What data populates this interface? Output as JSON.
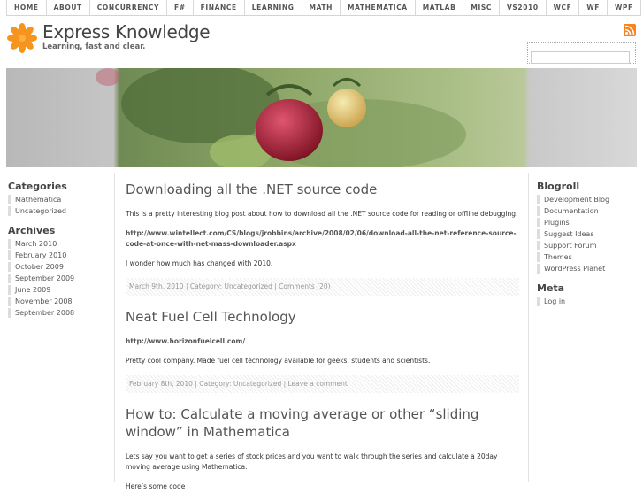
{
  "nav": [
    "HOME",
    "ABOUT",
    "CONCURRENCY",
    "F#",
    "FINANCE",
    "LEARNING",
    "MATH",
    "MATHEMATICA",
    "MATLAB",
    "MISC",
    "VS2010",
    "WCF",
    "WF",
    "WPF"
  ],
  "site": {
    "title": "Express Knowledge",
    "tagline": "Learning, fast and clear."
  },
  "sidebar_left": {
    "categories_heading": "Categories",
    "categories": [
      "Mathematica",
      "Uncategorized"
    ],
    "archives_heading": "Archives",
    "archives": [
      "March 2010",
      "February 2010",
      "October 2009",
      "September 2009",
      "June 2009",
      "November 2008",
      "September 2008"
    ]
  },
  "sidebar_right": {
    "blogroll_heading": "Blogroll",
    "blogroll": [
      "Development Blog",
      "Documentation",
      "Plugins",
      "Suggest Ideas",
      "Support Forum",
      "Themes",
      "WordPress Planet"
    ],
    "meta_heading": "Meta",
    "meta": [
      "Log in"
    ]
  },
  "posts": [
    {
      "title": "Downloading all the .NET source code",
      "intro": "This is a pretty interesting blog post about how to download all the .NET source code for reading  or offline debugging.",
      "link": "http://www.wintellect.com/CS/blogs/jrobbins/archive/2008/02/06/download-all-the-net-reference-source-code-at-once-with-net-mass-downloader.aspx",
      "body": "I wonder how much has changed with 2010.",
      "meta": {
        "date": "March 9th, 2010 | Category: ",
        "category": "Uncategorized",
        "sep": " | ",
        "comments": "Comments (20)"
      }
    },
    {
      "title": "Neat Fuel Cell Technology",
      "link": "http://www.horizonfuelcell.com/",
      "body": "Pretty cool company. Made fuel cell technology available for geeks, students and scientists.",
      "meta": {
        "date": "February 8th, 2010 | Category: ",
        "category": "Uncategorized",
        "sep": " | ",
        "comments": "Leave a comment"
      }
    },
    {
      "title": "How to: Calculate a moving average or other “sliding window” in Mathematica",
      "intro": "Lets say you want to get a series of stock prices and you want to walk through the series and calculate a 20day moving average using Mathematica.",
      "body": "Here’s some code"
    }
  ]
}
